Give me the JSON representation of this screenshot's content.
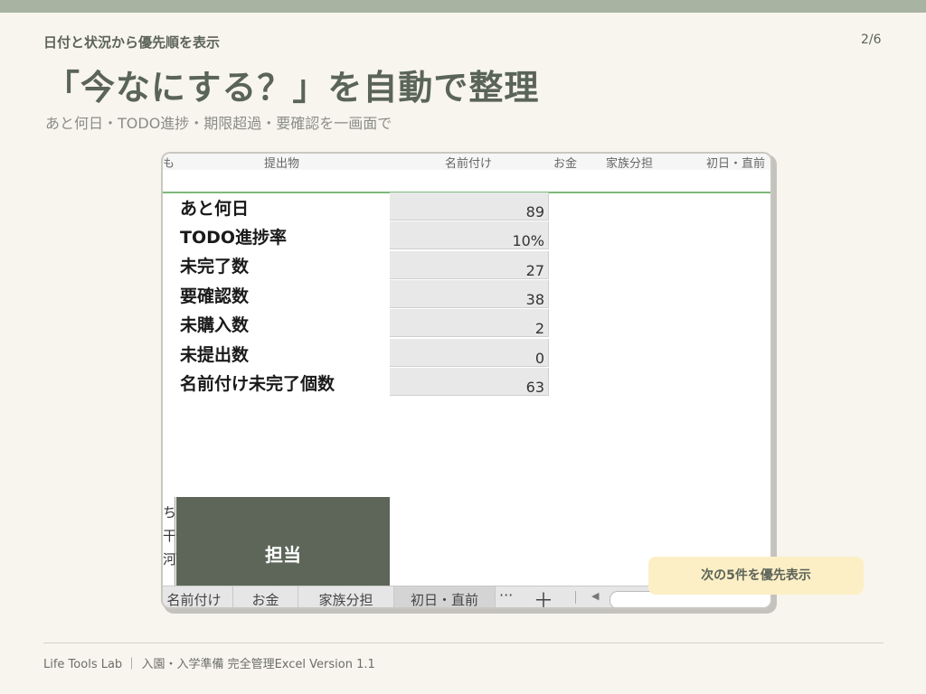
{
  "header": {
    "eyebrow": "日付と状況から優先順を表示",
    "page": "2/6",
    "title": "「今なにする？」を自動で整理",
    "subtitle": "あと何日・TODO進捗・期限超過・要確認を一画面で"
  },
  "sheet": {
    "columns": [
      "も",
      "提出物",
      "名前付け",
      "お金",
      "家族分担",
      "初日・直前"
    ],
    "rows": [
      {
        "label": "あと何日",
        "value": "89"
      },
      {
        "label": "TODO進捗率",
        "value": "10%"
      },
      {
        "label": "未完了数",
        "value": "27"
      },
      {
        "label": "要確認数",
        "value": "38"
      },
      {
        "label": "未購入数",
        "value": "2"
      },
      {
        "label": "未提出数",
        "value": "0"
      },
      {
        "label": "名前付け未完了個数",
        "value": "63"
      }
    ],
    "side_glyphs": "ち\n干\n河",
    "assignee_header": "担当",
    "tabs": [
      "名前付け",
      "お金",
      "家族分担",
      "初日・直前"
    ],
    "active_tab": "初日・直前",
    "more": "···",
    "add": "＋"
  },
  "cta": {
    "label": "次の5件を優先表示"
  },
  "footer": {
    "text": "Life Tools Lab ｜ 入園・入学準備 完全管理Excel  Version 1.1"
  },
  "colors": {
    "background": "#f8f5ee",
    "top_bar": "#a8b4a1",
    "title": "#5a6457",
    "header_cell": "#5d6659",
    "cta_background": "#fcefc6",
    "value_cell": "#e8e8e8",
    "gridline_accent": "#7cb87a"
  }
}
